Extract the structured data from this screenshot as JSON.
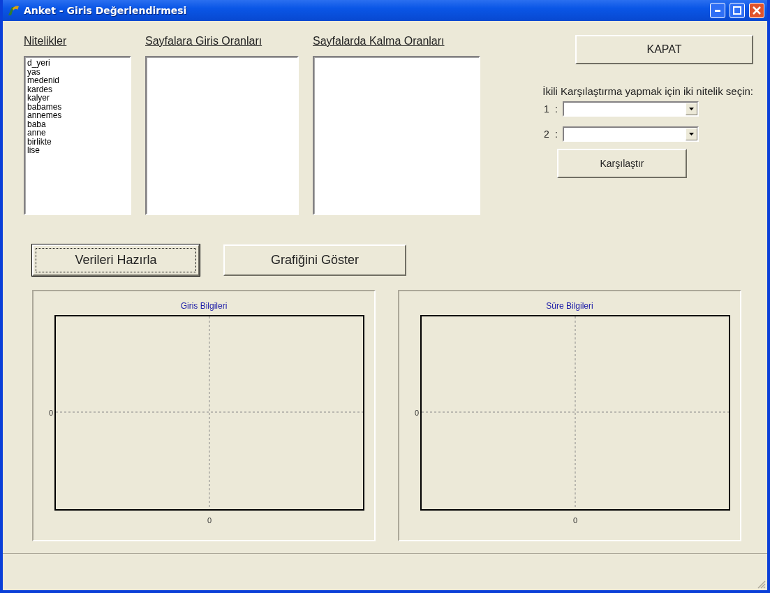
{
  "window": {
    "title": "Anket - Giris Değerlendirmesi"
  },
  "lists": [
    {
      "heading": "Nitelikler",
      "items": [
        "d_yeri",
        "yas",
        "medenid",
        "kardes",
        "kalyer",
        "babames",
        "annemes",
        "baba",
        "anne",
        "birlikte",
        "lise"
      ]
    },
    {
      "heading": "Sayfalara Giris Oranları"
    },
    {
      "heading": "Sayfalarda Kalma Oranları"
    }
  ],
  "close_button": "KAPAT",
  "compare": {
    "prompt": "İkili Karşılaştırma yapmak için iki nitelik seçin:",
    "selects": [
      {
        "label": "1",
        "separator": ":"
      },
      {
        "label": "2",
        "separator": ":"
      }
    ],
    "button": "Karşılaştır"
  },
  "actions": [
    {
      "label": "Verileri Hazırla",
      "focused": true
    },
    {
      "label": "Grafiğini Göster",
      "focused": false
    }
  ],
  "charts": [
    {
      "title": "Giris Bilgileri",
      "y_tick": "0",
      "x_tick": "0"
    },
    {
      "title": "Süre Bilgileri",
      "y_tick": "0",
      "x_tick": "0"
    }
  ]
}
